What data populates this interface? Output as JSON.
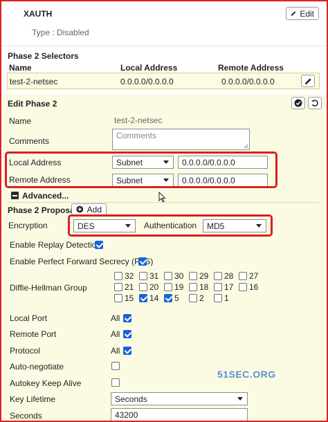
{
  "xauth": {
    "title": "XAUTH",
    "type_text": "Type : Disabled",
    "edit_label": "Edit"
  },
  "selectors": {
    "title": "Phase 2 Selectors",
    "columns": [
      "Name",
      "Local Address",
      "Remote Address"
    ],
    "row": {
      "name": "test-2-netsec",
      "local": "0.0.0.0/0.0.0.0",
      "remote": "0.0.0.0/0.0.0.0"
    }
  },
  "edit": {
    "title": "Edit Phase 2",
    "name_label": "Name",
    "name_value": "test-2-netsec",
    "comments_label": "Comments",
    "comments_placeholder": "Comments",
    "local_label": "Local Address",
    "local_type": "Subnet",
    "local_value": "0.0.0.0/0.0.0.0",
    "remote_label": "Remote Address",
    "remote_type": "Subnet",
    "remote_value": "0.0.0.0/0.0.0.0",
    "advanced_label": "Advanced..."
  },
  "proposal": {
    "title": "Phase 2 Proposal",
    "add_label": "Add",
    "encryption_label": "Encryption",
    "encryption_value": "DES",
    "auth_label": "Authentication",
    "auth_value": "MD5"
  },
  "options": {
    "replay_label": "Enable Replay Detection",
    "replay_checked": true,
    "pfs_label": "Enable Perfect Forward Secrecy (PFS)",
    "pfs_checked": true,
    "dh_label": "Diffie-Hellman Group",
    "dh_groups": [
      {
        "label": "32",
        "checked": false
      },
      {
        "label": "31",
        "checked": false
      },
      {
        "label": "30",
        "checked": false
      },
      {
        "label": "29",
        "checked": false
      },
      {
        "label": "28",
        "checked": false
      },
      {
        "label": "27",
        "checked": false
      },
      {
        "label": "21",
        "checked": false
      },
      {
        "label": "20",
        "checked": false
      },
      {
        "label": "19",
        "checked": false
      },
      {
        "label": "18",
        "checked": false
      },
      {
        "label": "17",
        "checked": false
      },
      {
        "label": "16",
        "checked": false
      },
      {
        "label": "15",
        "checked": false
      },
      {
        "label": "14",
        "checked": true
      },
      {
        "label": "5",
        "checked": true
      },
      {
        "label": "2",
        "checked": false
      },
      {
        "label": "1",
        "checked": false
      }
    ],
    "local_port_label": "Local Port",
    "local_port_value": "All",
    "remote_port_label": "Remote Port",
    "remote_port_value": "All",
    "protocol_label": "Protocol",
    "protocol_value": "All",
    "auto_negotiate_label": "Auto-negotiate",
    "autokey_label": "Autokey Keep Alive",
    "key_lifetime_label": "Key Lifetime",
    "key_lifetime_value": "Seconds",
    "seconds_label": "Seconds",
    "seconds_value": "43200"
  },
  "watermark": "51SEC.ORG",
  "colors": {
    "accent": "#1565d8",
    "highlight": "#fbfbe4",
    "annotation": "#d92020"
  }
}
